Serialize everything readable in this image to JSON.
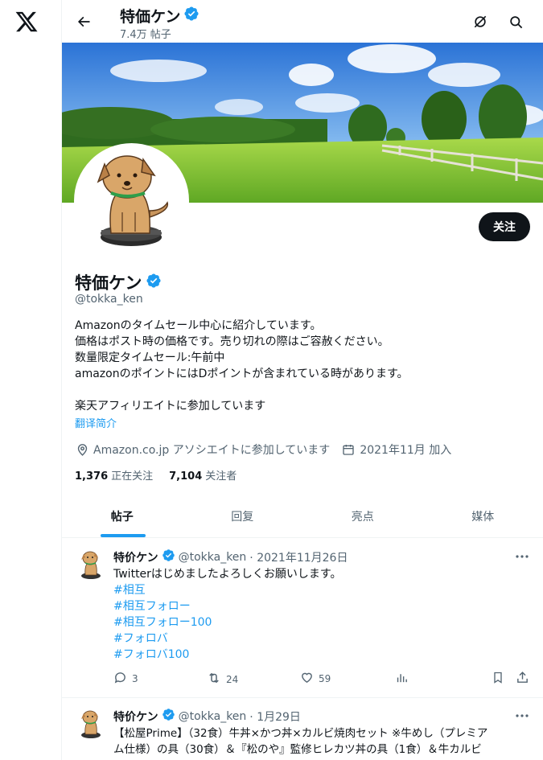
{
  "profile": {
    "name": "特価ケン",
    "post_count": "7.4万 帖子",
    "handle": "@tokka_ken",
    "bio": [
      "Amazonのタイムセール中心に紹介しています。",
      "価格はポスト時の価格です。売り切れの際はご容赦ください。",
      "数量限定タイムセール:午前中",
      "amazonのポイントにはDポイントが含まれている時があります。",
      "",
      "楽天アフィリエイトに参加しています"
    ],
    "translate": "翻译简介",
    "affiliation": "Amazon.co.jp アソシエイトに参加しています",
    "joined": "2021年11月 加入",
    "following_count": "1,376",
    "following_label": "正在关注",
    "followers_count": "7,104",
    "followers_label": "关注者",
    "follow_button": "关注",
    "verified_color": "#1d9bf0"
  },
  "tabs": [
    {
      "label": "帖子",
      "active": true
    },
    {
      "label": "回复",
      "active": false
    },
    {
      "label": "亮点",
      "active": false
    },
    {
      "label": "媒体",
      "active": false
    }
  ],
  "posts": [
    {
      "name": "特价ケン",
      "handle": "@tokka_ken",
      "date": "· 2021年11月26日",
      "lines": [
        "Twitterはじめましたよろしくお願いします。"
      ],
      "tags": [
        "#相互",
        "#相互フォロー",
        "#相互フォロー100",
        "#フォロバ",
        "#フォロバ100"
      ],
      "replies": "3",
      "reposts": "24",
      "likes": "59"
    },
    {
      "name": "特价ケン",
      "handle": "@tokka_ken",
      "date": "· 1月29日",
      "lines": [
        "【松屋Prime】（32食）牛丼×かつ丼×カルビ焼肉セット ※牛めし（プレミア",
        "ム仕様）の具（30食）＆『松のや』監修ヒレカツ丼の具（1食）＆牛カルビ"
      ]
    }
  ],
  "colors": {
    "accent": "#1d9bf0",
    "text": "#0f1419",
    "muted": "#536471"
  },
  "icons": [
    "x-logo-icon",
    "back-arrow-icon",
    "verified-badge-icon",
    "notifications-off-icon",
    "search-icon",
    "location-icon",
    "calendar-icon",
    "reply-icon",
    "repost-icon",
    "like-icon",
    "views-icon",
    "bookmark-icon",
    "share-icon",
    "more-icon"
  ]
}
